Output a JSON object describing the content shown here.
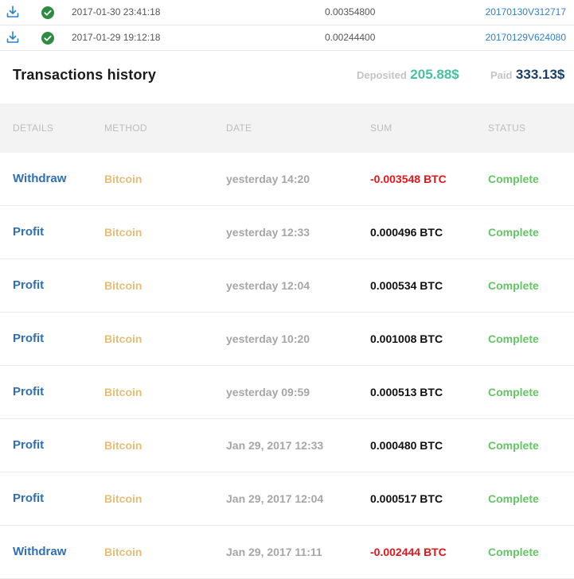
{
  "transfers": [
    {
      "datetime": "2017-01-30 23:41:18",
      "amount": "0.00354800",
      "id": "20170130V312717"
    },
    {
      "datetime": "2017-01-29 19:12:18",
      "amount": "0.00244400",
      "id": "20170129V624080"
    }
  ],
  "header": {
    "title": "Transactions history",
    "deposited_label": "Deposited",
    "deposited_value": "205.88$",
    "paid_label": "Paid",
    "paid_value": "333.13$"
  },
  "columns": {
    "details": "DETAILS",
    "method": "METHOD",
    "date": "DATE",
    "sum": "SUM",
    "status": "STATUS"
  },
  "transactions": [
    {
      "details": "Withdraw",
      "method": "Bitcoin",
      "date": "yesterday 14:20",
      "sum": "-0.003548 BTC",
      "negative": true,
      "status": "Complete"
    },
    {
      "details": "Profit",
      "method": "Bitcoin",
      "date": "yesterday 12:33",
      "sum": "0.000496 BTC",
      "negative": false,
      "status": "Complete"
    },
    {
      "details": "Profit",
      "method": "Bitcoin",
      "date": "yesterday 12:04",
      "sum": "0.000534 BTC",
      "negative": false,
      "status": "Complete"
    },
    {
      "details": "Profit",
      "method": "Bitcoin",
      "date": "yesterday 10:20",
      "sum": "0.001008 BTC",
      "negative": false,
      "status": "Complete"
    },
    {
      "details": "Profit",
      "method": "Bitcoin",
      "date": "yesterday 09:59",
      "sum": "0.000513 BTC",
      "negative": false,
      "status": "Complete"
    },
    {
      "details": "Profit",
      "method": "Bitcoin",
      "date": "Jan 29, 2017 12:33",
      "sum": "0.000480 BTC",
      "negative": false,
      "status": "Complete"
    },
    {
      "details": "Profit",
      "method": "Bitcoin",
      "date": "Jan 29, 2017 12:04",
      "sum": "0.000517 BTC",
      "negative": false,
      "status": "Complete"
    },
    {
      "details": "Withdraw",
      "method": "Bitcoin",
      "date": "Jan 29, 2017 11:11",
      "sum": "-0.002444 BTC",
      "negative": true,
      "status": "Complete"
    }
  ],
  "colors": {
    "link_blue": "#2f6fb6",
    "method_gold": "#e6bd74",
    "negative_red": "#e8141c",
    "status_green": "#63c563",
    "deposited_teal": "#46c2a1",
    "paid_navy": "#1b3f66"
  },
  "icons": {
    "download": "download-icon",
    "check": "check-circle-icon"
  }
}
